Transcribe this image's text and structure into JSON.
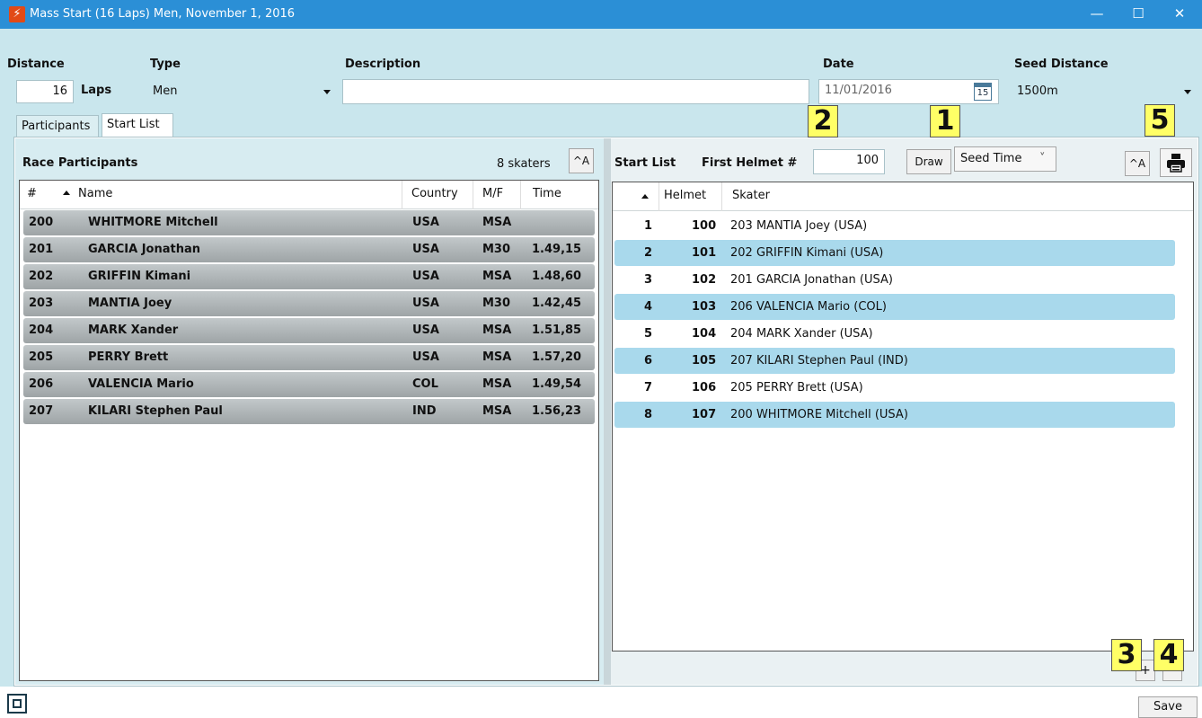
{
  "window": {
    "title": "Mass Start (16 Laps) Men, November 1, 2016",
    "minimize": "—",
    "maximize": "☐",
    "close": "✕"
  },
  "header": {
    "distance_label": "Distance",
    "distance_value": "16",
    "laps_label": "Laps",
    "type_label": "Type",
    "type_value": "Men",
    "description_label": "Description",
    "description_value": "",
    "date_label": "Date",
    "date_value": "11/01/2016",
    "calendar_day": "15",
    "seed_distance_label": "Seed Distance",
    "seed_distance_value": "1500m"
  },
  "tabs": [
    {
      "label": "Participants",
      "active": false
    },
    {
      "label": "Start List",
      "active": true
    }
  ],
  "participants": {
    "title": "Race Participants",
    "count_text": "8 skaters",
    "font_button": "^A",
    "columns": [
      "#",
      "Name",
      "Country",
      "M/F",
      "Time"
    ],
    "rows": [
      {
        "num": "200",
        "name": "WHITMORE Mitchell",
        "country": "USA",
        "mf": "MSA",
        "time": ""
      },
      {
        "num": "201",
        "name": "GARCIA Jonathan",
        "country": "USA",
        "mf": "M30",
        "time": "1.49,15"
      },
      {
        "num": "202",
        "name": "GRIFFIN Kimani",
        "country": "USA",
        "mf": "MSA",
        "time": "1.48,60"
      },
      {
        "num": "203",
        "name": "MANTIA Joey",
        "country": "USA",
        "mf": "M30",
        "time": "1.42,45"
      },
      {
        "num": "204",
        "name": "MARK Xander",
        "country": "USA",
        "mf": "MSA",
        "time": "1.51,85"
      },
      {
        "num": "205",
        "name": "PERRY Brett",
        "country": "USA",
        "mf": "MSA",
        "time": "1.57,20"
      },
      {
        "num": "206",
        "name": "VALENCIA Mario",
        "country": "COL",
        "mf": "MSA",
        "time": "1.49,54"
      },
      {
        "num": "207",
        "name": "KILARI Stephen Paul",
        "country": "IND",
        "mf": "MSA",
        "time": "1.56,23"
      }
    ]
  },
  "startlist": {
    "title": "Start List",
    "first_helmet_label": "First Helmet #",
    "first_helmet_value": "100",
    "draw_button": "Draw",
    "order_value": "Seed Time",
    "order_caret": "˅",
    "font_button": "^A",
    "columns": [
      "Helmet",
      "Skater"
    ],
    "rows": [
      {
        "pos": "1",
        "helmet": "100",
        "skater": "203 MANTIA Joey (USA)"
      },
      {
        "pos": "2",
        "helmet": "101",
        "skater": "202 GRIFFIN Kimani (USA)"
      },
      {
        "pos": "3",
        "helmet": "102",
        "skater": "201 GARCIA Jonathan (USA)"
      },
      {
        "pos": "4",
        "helmet": "103",
        "skater": "206 VALENCIA Mario (COL)"
      },
      {
        "pos": "5",
        "helmet": "104",
        "skater": "204 MARK Xander (USA)"
      },
      {
        "pos": "6",
        "helmet": "105",
        "skater": "207 KILARI Stephen Paul (IND)"
      },
      {
        "pos": "7",
        "helmet": "106",
        "skater": "205 PERRY Brett (USA)"
      },
      {
        "pos": "8",
        "helmet": "107",
        "skater": "200 WHITMORE Mitchell (USA)"
      }
    ],
    "add_button": "+",
    "remove_button": "-"
  },
  "callouts": [
    "1",
    "2",
    "3",
    "4",
    "5"
  ],
  "footer": {
    "save_button": "Save"
  },
  "colors": {
    "titlebar": "#2b8fd6",
    "window_bg": "#c9e6ed",
    "row_highlight": "#a9d9ec",
    "callout": "#ffff66"
  }
}
